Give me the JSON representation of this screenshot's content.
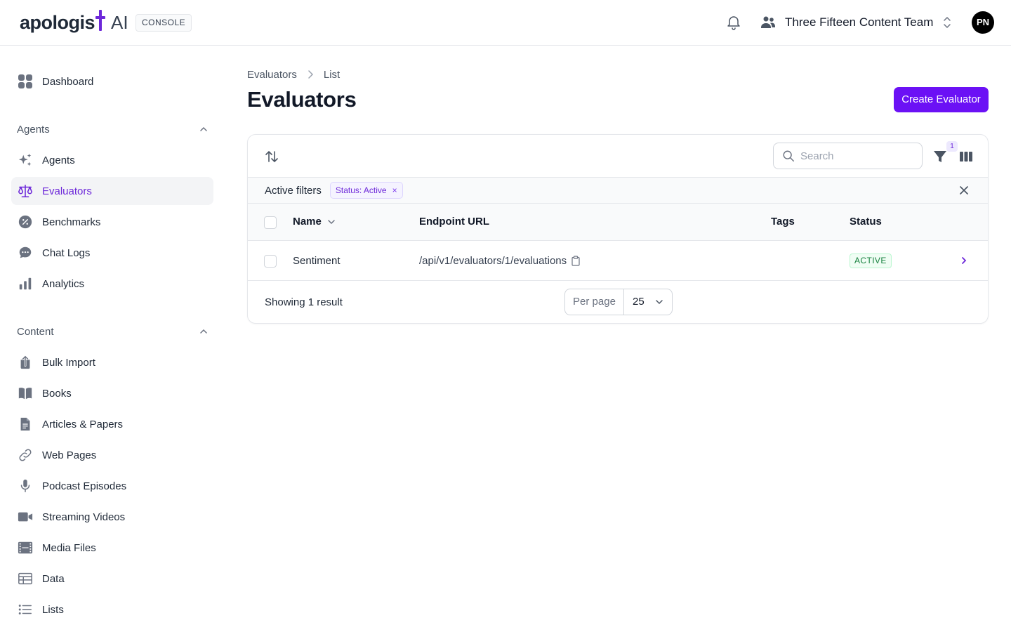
{
  "header": {
    "logo_text": "apologis",
    "logo_suffix": "AI",
    "console_badge": "CONSOLE",
    "team_name": "Three Fifteen Content Team",
    "avatar_initials": "PN"
  },
  "sidebar": {
    "dashboard": {
      "label": "Dashboard",
      "icon": "dashboard-icon"
    },
    "agents_section": {
      "label": "Agents",
      "icon": "chevron-up-icon"
    },
    "agents_items": [
      {
        "label": "Agents",
        "icon": "sparkles-icon"
      },
      {
        "label": "Evaluators",
        "icon": "scale-icon",
        "active": true
      },
      {
        "label": "Benchmarks",
        "icon": "percent-badge-icon"
      },
      {
        "label": "Chat Logs",
        "icon": "chat-bubble-icon"
      },
      {
        "label": "Analytics",
        "icon": "bar-chart-icon"
      }
    ],
    "content_section": {
      "label": "Content",
      "icon": "chevron-up-icon"
    },
    "content_items": [
      {
        "label": "Bulk Import",
        "icon": "upload-icon"
      },
      {
        "label": "Books",
        "icon": "book-icon"
      },
      {
        "label": "Articles & Papers",
        "icon": "document-icon"
      },
      {
        "label": "Web Pages",
        "icon": "link-icon"
      },
      {
        "label": "Podcast Episodes",
        "icon": "microphone-icon"
      },
      {
        "label": "Streaming Videos",
        "icon": "video-camera-icon"
      },
      {
        "label": "Media Files",
        "icon": "film-icon"
      },
      {
        "label": "Data",
        "icon": "table-icon"
      },
      {
        "label": "Lists",
        "icon": "list-icon"
      }
    ]
  },
  "breadcrumb": {
    "root": "Evaluators",
    "current": "List"
  },
  "page": {
    "title": "Evaluators",
    "create_button": "Create Evaluator"
  },
  "toolbar": {
    "search_placeholder": "Search",
    "search_value": "",
    "filter_count": "1"
  },
  "filters": {
    "label": "Active filters",
    "chip": "Status: Active",
    "chip_remove": "×"
  },
  "table": {
    "columns": {
      "name": "Name",
      "endpoint": "Endpoint URL",
      "tags": "Tags",
      "status": "Status"
    },
    "rows": [
      {
        "name": "Sentiment",
        "endpoint": "/api/v1/evaluators/1/evaluations",
        "tags": "",
        "status": "ACTIVE"
      }
    ]
  },
  "footer": {
    "result_count": "Showing 1 result",
    "per_page_label": "Per page",
    "per_page_value": "25"
  },
  "colors": {
    "accent": "#6b11f5",
    "active_text": "#6d28d9",
    "status_green": "#15803d"
  }
}
